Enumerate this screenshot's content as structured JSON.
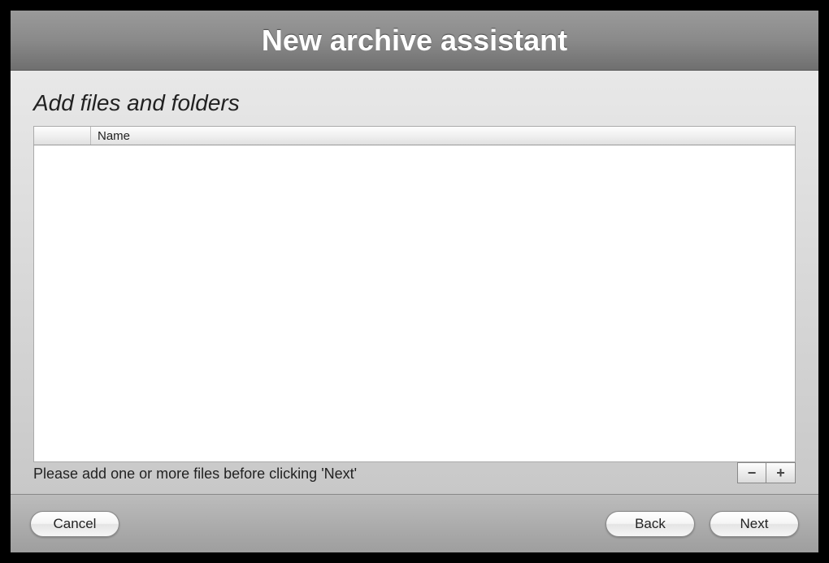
{
  "header": {
    "title": "New archive assistant"
  },
  "main": {
    "subtitle": "Add files and folders",
    "table": {
      "columns": {
        "name": "Name"
      },
      "rows": []
    },
    "buttons": {
      "remove_label": "−",
      "add_label": "+"
    },
    "hint": "Please add one or more files before clicking 'Next'"
  },
  "footer": {
    "cancel_label": "Cancel",
    "back_label": "Back",
    "next_label": "Next"
  }
}
